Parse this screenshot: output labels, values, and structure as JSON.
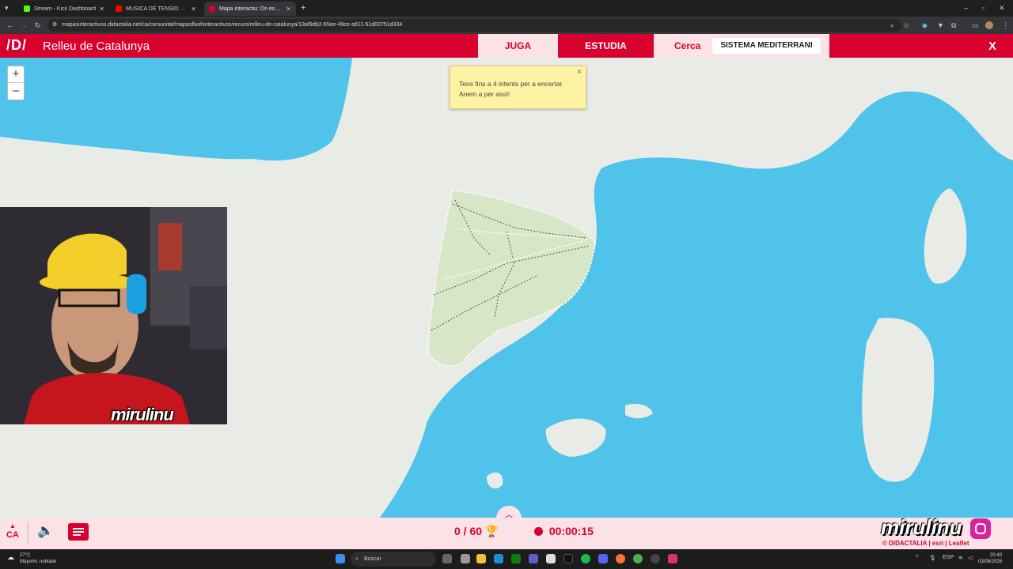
{
  "browser": {
    "tabs": [
      {
        "title": "Stream - Kick Dashboard",
        "color": "#53fc18"
      },
      {
        "title": "MÚSICA DE TENSIÓ D'\"EL...",
        "color": "#ff0000"
      },
      {
        "title": "Mapa interactiu: On és? Relleu...",
        "color": "#d8002e"
      }
    ],
    "new_tab": "+",
    "url": "mapasinteractivos.didactalia.net/ca/comunitat/mapasflashinteractivos/recurs/relleu-de-catalunya/13af9db2-65ee-49ce-a611-51d00751d334"
  },
  "app": {
    "logo": "/D/",
    "title": "Relleu de Catalunya",
    "nav": {
      "juga": "JUGA",
      "estudia": "ESTUDIA",
      "cerca": "Cerca"
    },
    "search_value": "SISTEMA MEDITERRANI",
    "close": "X"
  },
  "map": {
    "zoom_in": "+",
    "zoom_out": "–",
    "tooltip_line1": "Tens fins a 4 intents per a encertar.",
    "tooltip_line2": "Anem a per això!",
    "tooltip_close": "×",
    "sea_color": "#4fc3ea",
    "land_color": "#e9ebe6",
    "region_color": "#d7e6c6"
  },
  "webcam": {
    "overlay_text": "mirulinu"
  },
  "bottom": {
    "language": "CA",
    "score": "0 / 60",
    "timer": "00:00:15",
    "watermark": "mirulinu",
    "credits": "© DIDACTALIA | esri | Leaflet"
  },
  "taskbar": {
    "temperature": "27°C",
    "weather_desc": "Mayorm. nublado",
    "search_placeholder": "Buscar",
    "lang": "ESP",
    "time": "20:40",
    "date": "03/08/2026"
  }
}
